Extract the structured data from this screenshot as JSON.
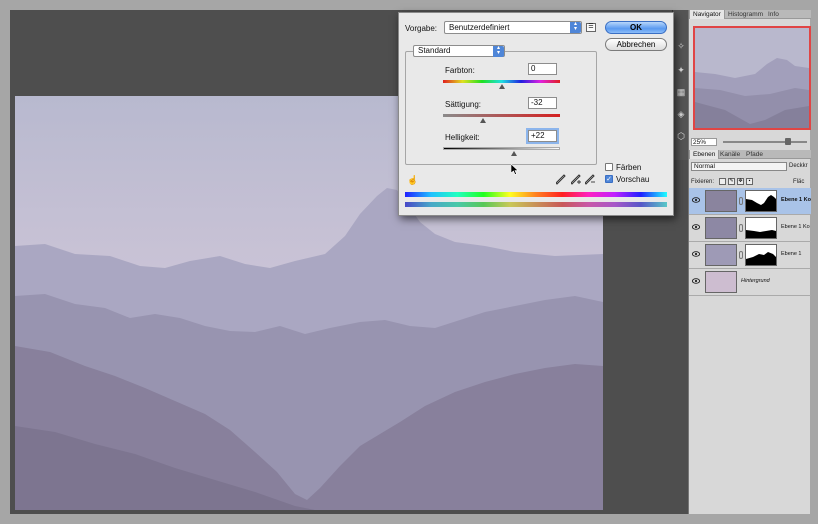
{
  "dialog": {
    "preset_label": "Vorgabe:",
    "preset_value": "Benutzerdefiniert",
    "ok_label": "OK",
    "cancel_label": "Abbrechen",
    "mode_value": "Standard",
    "hue": {
      "label": "Farbton:",
      "value": "0",
      "level": 0.5
    },
    "saturation": {
      "label": "Sättigung:",
      "value": "-32",
      "level": 0.34
    },
    "lightness": {
      "label": "Helligkeit:",
      "value": "+22",
      "level": 0.61
    },
    "colorize_label": "Färben",
    "colorize_checked": false,
    "preview_label": "Vorschau",
    "preview_checked": true
  },
  "navigator": {
    "tabs": [
      "Navigator",
      "Histogramm",
      "Info"
    ],
    "zoom": "25%"
  },
  "layers": {
    "tabs": [
      "Ebenen",
      "Kanäle",
      "Pfade"
    ],
    "blend_mode": "Normal",
    "opacity_label": "Deckkr",
    "lock_label": "Fixieren:",
    "fill_label": "Fläc",
    "items": [
      {
        "name": "Ebene 1 Ko",
        "selected": true
      },
      {
        "name": "Ebene 1 Ko",
        "selected": false
      },
      {
        "name": "Ebene 1",
        "selected": false
      },
      {
        "name": "Hintergrund",
        "selected": false
      }
    ]
  },
  "colors": {
    "workspace": "#4e4e4e",
    "accent": "#4f86d8",
    "selection": "#a9c3e8"
  }
}
